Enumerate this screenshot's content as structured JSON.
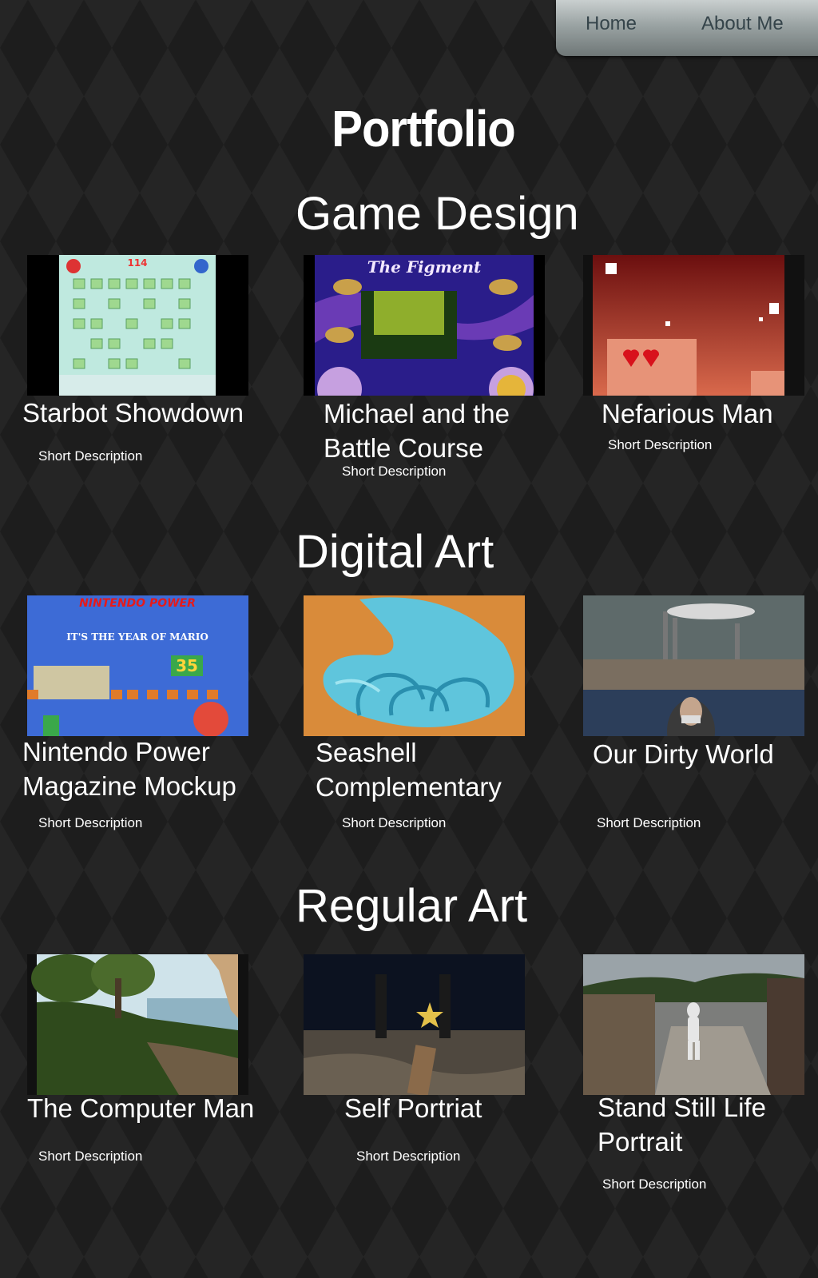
{
  "nav": {
    "home": "Home",
    "about": "About Me"
  },
  "page_title": "Portfolio",
  "sections": [
    {
      "heading": "Game Design",
      "items": [
        {
          "title": "Starbot Showdown",
          "description": "Short Description",
          "thumb_text": "114"
        },
        {
          "title": "Michael and the Battle Course",
          "description": "Short Description",
          "thumb_text": "The Figment"
        },
        {
          "title": "Nefarious Man",
          "description": "Short Description"
        }
      ]
    },
    {
      "heading": "Digital Art",
      "items": [
        {
          "title": "Nintendo Power Magazine Mockup",
          "description": "Short Description",
          "thumb_text": "NINTENDO POWER",
          "thumb_sub": "IT'S THE YEAR OF MARIO",
          "thumb_badge": "35"
        },
        {
          "title": "Seashell Complementary",
          "description": "Short Description"
        },
        {
          "title": "Our Dirty World",
          "description": "Short Description"
        }
      ]
    },
    {
      "heading": "Regular Art",
      "items": [
        {
          "title": "The Computer Man",
          "description": "Short Description"
        },
        {
          "title": "Self Portriat",
          "description": "Short Description"
        },
        {
          "title": "Stand Still Life Portrait",
          "description": "Short Description"
        }
      ]
    }
  ]
}
